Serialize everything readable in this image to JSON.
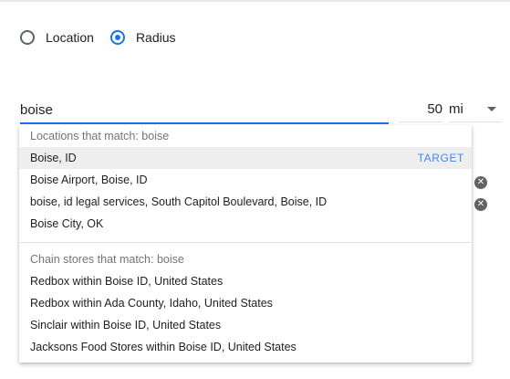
{
  "mode": {
    "options": [
      {
        "label": "Location",
        "selected": false
      },
      {
        "label": "Radius",
        "selected": true
      }
    ]
  },
  "search": {
    "value": "boise"
  },
  "radius": {
    "value": "50",
    "unit": "mi"
  },
  "suggestions": {
    "locations_header": "Locations that match: boise",
    "locations": [
      {
        "label": "Boise, ID",
        "action": "TARGET"
      },
      {
        "label": "Boise Airport, Boise, ID"
      },
      {
        "label": "boise, id legal services, South Capitol Boulevard, Boise, ID"
      },
      {
        "label": "Boise City, OK"
      }
    ],
    "chains_header": "Chain stores that match: boise",
    "chains": [
      {
        "label": "Redbox within Boise ID, United States"
      },
      {
        "label": "Redbox within Ada County, Idaho, United States"
      },
      {
        "label": "Sinclair within Boise ID, United States"
      },
      {
        "label": "Jacksons Food Stores within Boise ID, United States"
      }
    ]
  },
  "icons": {
    "remove": "close-circle-icon",
    "dropdown": "caret-down-icon"
  },
  "colors": {
    "accent": "#1a73e8",
    "target_link": "#4285f4",
    "highlight": "#eeeeee"
  }
}
